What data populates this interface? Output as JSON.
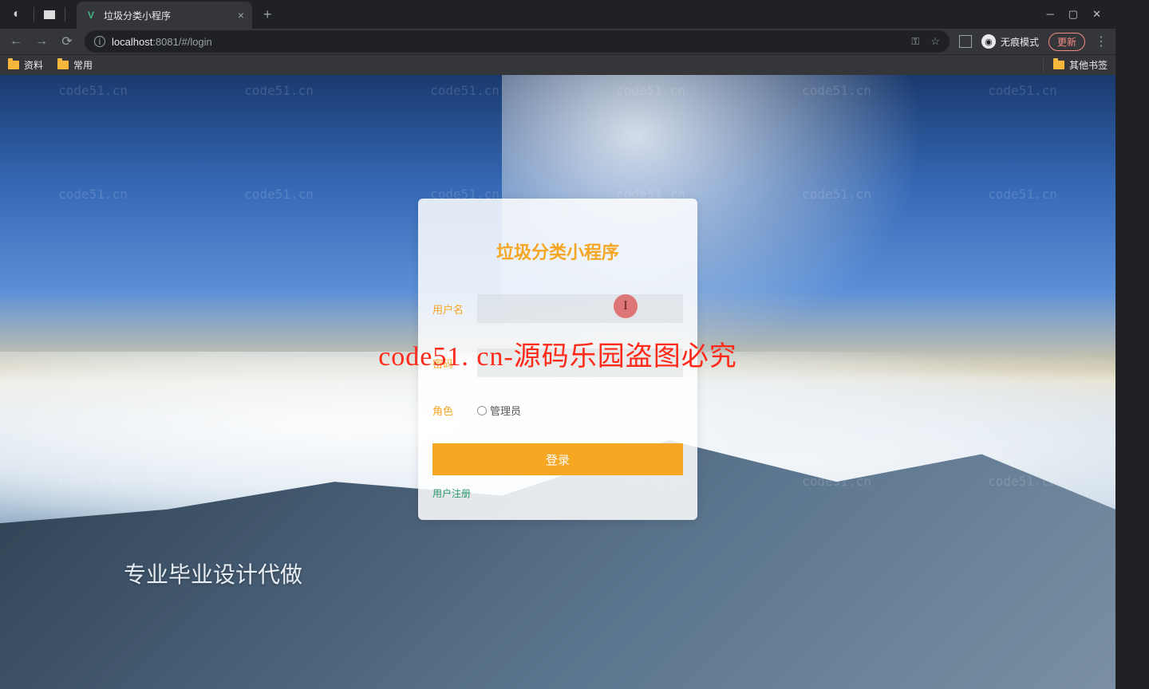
{
  "browser": {
    "tab": {
      "title": "垃圾分类小程序",
      "favicon": "V"
    },
    "url": {
      "host": "localhost",
      "port": ":8081",
      "path": "/#/login"
    },
    "incognito_label": "无痕模式",
    "update_label": "更新",
    "bookmarks": [
      "资料",
      "常用"
    ],
    "other_bookmarks": "其他书签"
  },
  "page": {
    "watermark_small": "code51.cn",
    "login": {
      "title": "垃圾分类小程序",
      "username_label": "用户名",
      "password_label": "密码",
      "role_label": "角色",
      "role_option": "管理员",
      "submit_label": "登录",
      "register_label": "用户注册"
    },
    "watermark_red": "code51. cn-源码乐园盗图必究",
    "bottom_caption": "专业毕业设计代做"
  }
}
